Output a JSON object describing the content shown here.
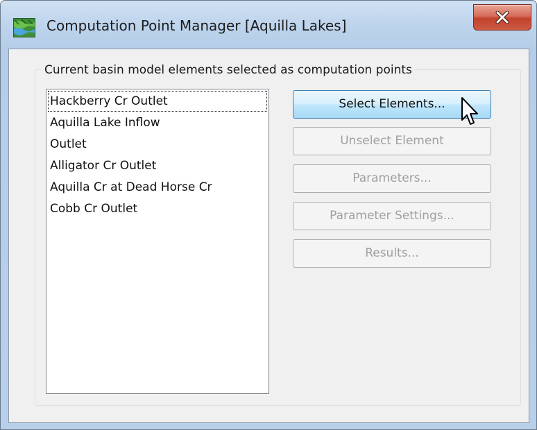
{
  "window": {
    "title": "Computation Point Manager [Aquilla Lakes]",
    "icon": "hec-hms-app-icon",
    "close_icon": "close-icon"
  },
  "group": {
    "label": "Current basin model elements selected as computation points"
  },
  "list": {
    "items": [
      "Hackberry Cr Outlet",
      "Aquilla Lake Inflow",
      "Outlet",
      "Alligator Cr Outlet",
      "Aquilla Cr at Dead Horse Cr",
      "Cobb Cr Outlet"
    ],
    "focused_index": 0
  },
  "buttons": {
    "select_elements": "Select Elements...",
    "unselect_element": "Unselect Element",
    "parameters": "Parameters...",
    "parameter_settings": "Parameter Settings...",
    "results": "Results..."
  },
  "colors": {
    "active_button_border": "#3c7fb1",
    "close_button": "#c3422c",
    "disabled_text": "#a0a0a0"
  }
}
